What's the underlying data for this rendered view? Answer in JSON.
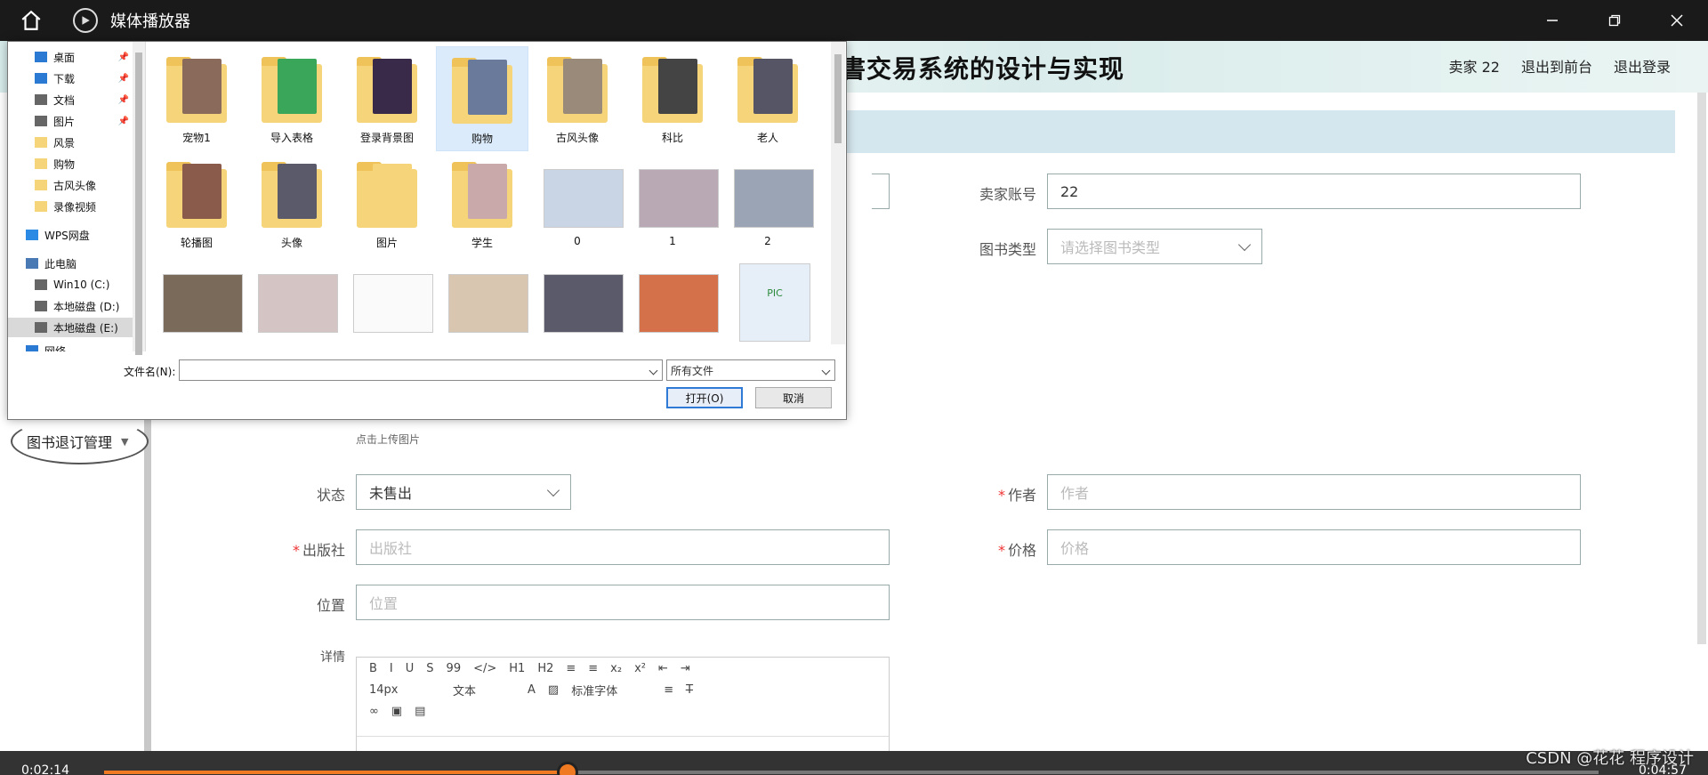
{
  "player": {
    "title": "媒体播放器",
    "time_current": "0:02:14",
    "time_total": "0:04:57",
    "progress_fraction": 0.31
  },
  "header": {
    "system_title": "書交易系统的设计与实现",
    "seller": "卖家 22",
    "exit_front": "退出到前台",
    "logout": "退出登录"
  },
  "sidebar": {
    "item_label": "图书退订管理"
  },
  "form": {
    "seller_account_label": "卖家账号",
    "seller_account_value": "22",
    "book_type_label": "图书类型",
    "book_type_placeholder": "请选择图书类型",
    "upload_hint": "点击上传图片",
    "status_label": "状态",
    "status_value": "未售出",
    "author_label": "作者",
    "author_placeholder": "作者",
    "publisher_label": "出版社",
    "publisher_placeholder": "出版社",
    "price_label": "价格",
    "price_placeholder": "价格",
    "location_label": "位置",
    "location_placeholder": "位置",
    "details_label": "详情",
    "required_mark": "*"
  },
  "editor": {
    "toolbar_row1": [
      "B",
      "I",
      "U",
      "S",
      "99",
      "</>",
      "H1",
      "H2",
      "≡",
      "≡",
      "x₂",
      "x²",
      "⇤",
      "⇥"
    ],
    "font_size": "14px",
    "text_style": "文本",
    "font_family": "标准字体"
  },
  "dialog": {
    "nav_items": [
      {
        "label": "桌面",
        "pinned": true
      },
      {
        "label": "下载",
        "pinned": true
      },
      {
        "label": "文档",
        "pinned": true
      },
      {
        "label": "图片",
        "pinned": true
      },
      {
        "label": "风景",
        "pinned": false
      },
      {
        "label": "购物",
        "pinned": false
      },
      {
        "label": "古风头像",
        "pinned": false
      },
      {
        "label": "录像视频",
        "pinned": false
      },
      {
        "label": "WPS网盘",
        "pinned": false
      },
      {
        "label": "此电脑",
        "pinned": false
      },
      {
        "label": "Win10 (C:)",
        "pinned": false
      },
      {
        "label": "本地磁盘 (D:)",
        "pinned": false
      },
      {
        "label": "本地磁盘 (E:)",
        "pinned": false
      },
      {
        "label": "网络",
        "pinned": false
      }
    ],
    "files": [
      {
        "name": "宠物1",
        "kind": "folder",
        "color": "#8a6a5a"
      },
      {
        "name": "导入表格",
        "kind": "folder",
        "color": "#3aa65a"
      },
      {
        "name": "登录背景图",
        "kind": "folder",
        "color": "#3a2a4a"
      },
      {
        "name": "购物",
        "kind": "folder",
        "color": "#6a7a9a",
        "selected": true
      },
      {
        "name": "古风头像",
        "kind": "folder",
        "color": "#9a8a7a"
      },
      {
        "name": "科比",
        "kind": "folder",
        "color": "#444444"
      },
      {
        "name": "老人",
        "kind": "folder",
        "color": "#555566"
      },
      {
        "name": "轮播图",
        "kind": "folder",
        "color": "#8a5a4a"
      },
      {
        "name": "头像",
        "kind": "folder",
        "color": "#5a5a6a"
      },
      {
        "name": "图片",
        "kind": "folder",
        "color": "#f6d47a"
      },
      {
        "name": "学生",
        "kind": "folder",
        "color": "#c9a9a9"
      },
      {
        "name": "0",
        "kind": "photo",
        "color": "#c9d4e4"
      },
      {
        "name": "1",
        "kind": "photo",
        "color": "#b9a9b4"
      },
      {
        "name": "2",
        "kind": "photo",
        "color": "#9aa4b4"
      },
      {
        "name": "",
        "kind": "photo",
        "color": "#7a6a5a"
      },
      {
        "name": "",
        "kind": "photo",
        "color": "#d4c4c4"
      },
      {
        "name": "",
        "kind": "photo",
        "color": "#fafafa"
      },
      {
        "name": "",
        "kind": "photo",
        "color": "#d8c6b0"
      },
      {
        "name": "",
        "kind": "photo",
        "color": "#5a5a6a"
      },
      {
        "name": "",
        "kind": "photo",
        "color": "#d4704a"
      },
      {
        "name": "",
        "kind": "pic",
        "color": "#e6eef8"
      }
    ],
    "filename_label": "文件名(N):",
    "filename_value": "",
    "filetype_value": "所有文件",
    "open_button": "打开(O)",
    "cancel_button": "取消"
  },
  "watermark": "CSDN @花花 程序设计"
}
